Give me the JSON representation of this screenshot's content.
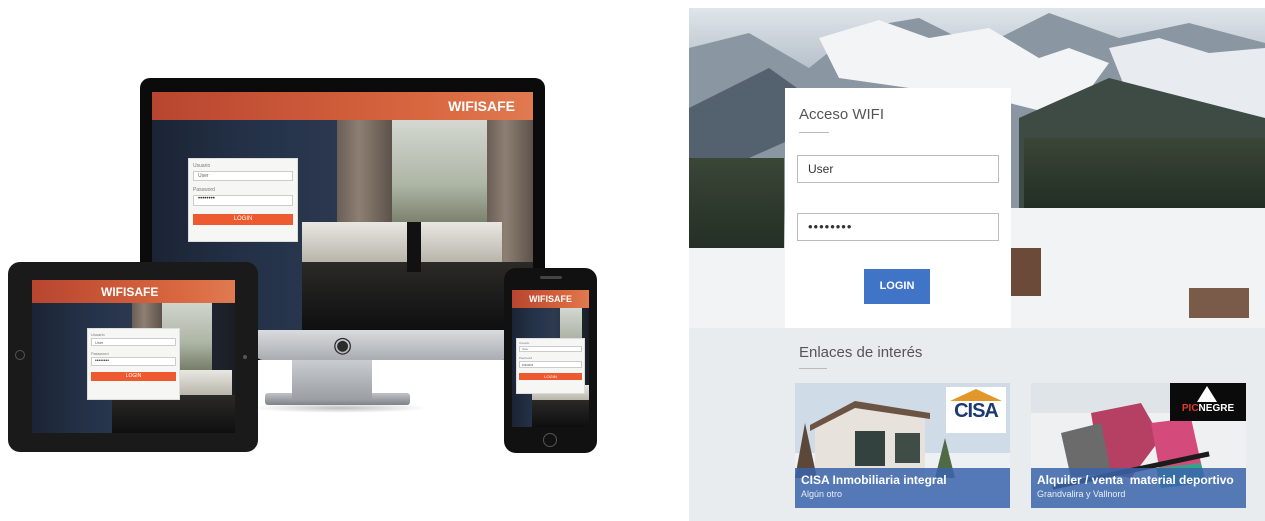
{
  "devices": {
    "imac": {
      "brand": "WIFISAFE",
      "user_label": "Usuario",
      "user_value": "User",
      "pass_label": "Password",
      "pass_value": "••••••••",
      "button": "LOGIN"
    },
    "tablet": {
      "brand": "WIFISAFE",
      "user_label": "Usuario",
      "user_value": "User",
      "pass_label": "Password",
      "pass_value": "••••••••",
      "button": "LOGIN"
    },
    "phone": {
      "brand": "WIFISAFE",
      "user_label": "Usuario",
      "user_value": "User",
      "pass_label": "Password",
      "pass_value": "••••••••",
      "button": "LOGIN"
    }
  },
  "portal": {
    "access_title": "Acceso WIFI",
    "username_value": "User",
    "password_value": "••••••••",
    "login_button": "LOGIN",
    "links_title": "Enlaces de interés",
    "links": [
      {
        "title": "CISA Inmobiliaria integral",
        "subtitle": "Algún otro",
        "logo_text": "CISA"
      },
      {
        "title": "Alquiler / venta  material deportivo",
        "subtitle": "Grandvalira y Vallnord",
        "logo_text_a": "PIC",
        "logo_text_b": "NEGRE"
      }
    ]
  },
  "colors": {
    "brand_orange": "#d8663f",
    "login_orange": "#ee5a2f",
    "portal_blue": "#3f74c6"
  }
}
